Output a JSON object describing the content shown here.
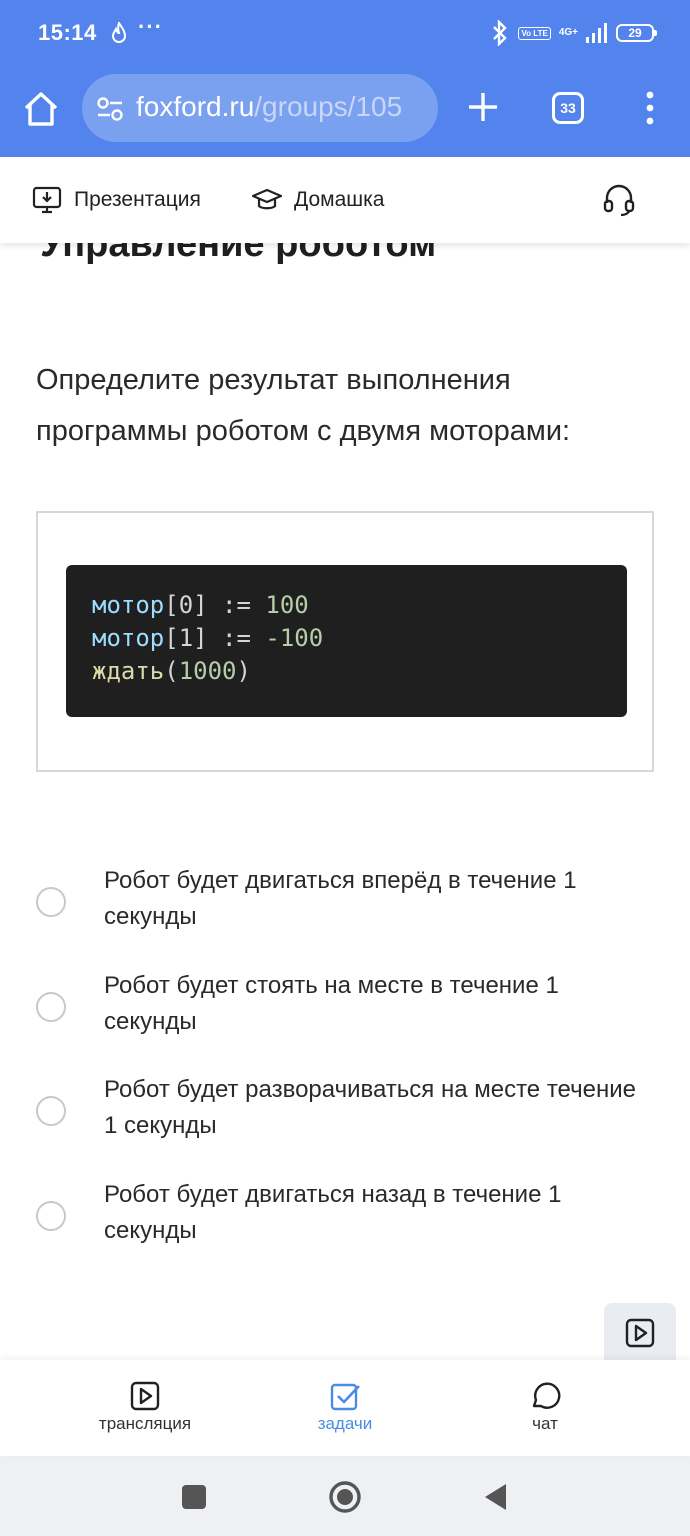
{
  "status": {
    "time": "15:14",
    "dots": "···",
    "volte": "Vo LTE",
    "network": "4G+",
    "battery": "29"
  },
  "browser": {
    "url_host": "foxford.ru",
    "url_path": "/groups/105",
    "tab_count": "33"
  },
  "page_nav": {
    "presentation": "Презентация",
    "homework": "Домашка"
  },
  "content": {
    "title": "Управление роботом",
    "question": "Определите результат выполнения программы роботом с двумя моторами:",
    "code": {
      "line1": {
        "name": "мотор",
        "index": "[0]",
        "op": " := ",
        "value": "100"
      },
      "line2": {
        "name": "мотор",
        "index": "[1]",
        "op": " := ",
        "value": "-100"
      },
      "line3": {
        "fn": "ждать",
        "open": "(",
        "value": "1000",
        "close": ")"
      }
    },
    "options": [
      {
        "label": "Робот будет двигаться вперёд в течение 1 секунды"
      },
      {
        "label": "Робот будет стоять на месте в течение 1 секунды"
      },
      {
        "label": "Робот будет разворачиваться на месте течение 1 секунды"
      },
      {
        "label": "Робот будет двигаться назад в течение 1 секунды"
      }
    ]
  },
  "tabs": [
    {
      "label": "трансляция",
      "icon": "play-square-icon"
    },
    {
      "label": "задачи",
      "icon": "checkbox-icon",
      "active": true
    },
    {
      "label": "чат",
      "icon": "chat-bubble-icon"
    }
  ],
  "colors": {
    "browser_bar": "#5383ec",
    "active_tab": "#4a8be6",
    "code_bg": "#1f1f1f"
  }
}
